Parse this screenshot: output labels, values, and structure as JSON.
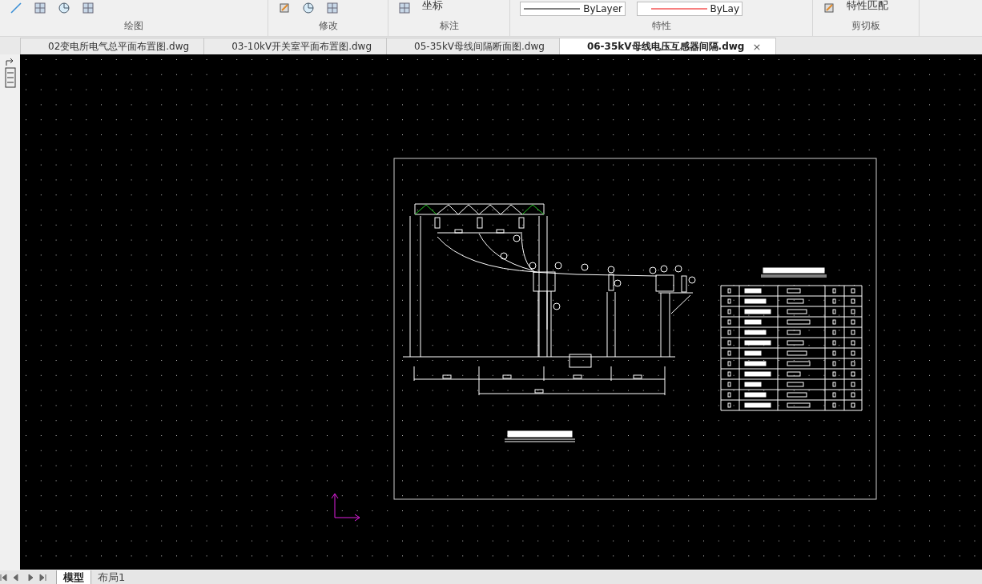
{
  "ribbon": {
    "groups": [
      {
        "label": "绘图",
        "kind": "draw"
      },
      {
        "label": "修改",
        "kind": "modify"
      },
      {
        "label": "标注",
        "kind": "annotate",
        "button": "坐标"
      },
      {
        "label": "特性",
        "kind": "properties",
        "linetype": "ByLayer",
        "color_value": "ByLay"
      },
      {
        "label": "剪切板",
        "kind": "clipboard",
        "button": "特性匹配"
      }
    ]
  },
  "file_tabs": [
    {
      "label": "02变电所电气总平面布置图.dwg",
      "selected": false
    },
    {
      "label": "03-10kV开关室平面布置图.dwg",
      "selected": false
    },
    {
      "label": "05-35kV母线间隔断面图.dwg",
      "selected": false
    },
    {
      "label": "06-35kV母线电压互感器间隔.dwg",
      "selected": true
    }
  ],
  "close_glyph": "×",
  "layout_tabs": [
    {
      "label": "模型",
      "selected": true
    },
    {
      "label": "布局1",
      "selected": false
    }
  ]
}
